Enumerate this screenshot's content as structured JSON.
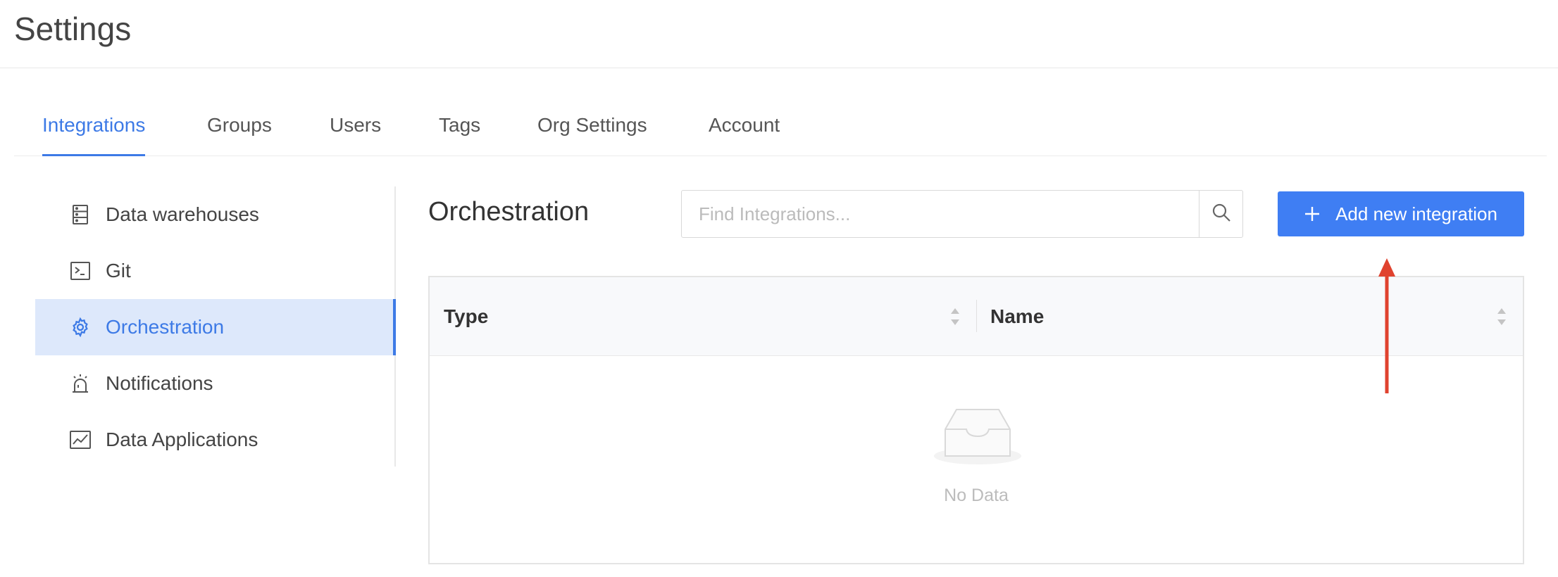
{
  "page": {
    "title": "Settings"
  },
  "tabs": [
    {
      "label": "Integrations",
      "active": true
    },
    {
      "label": "Groups",
      "active": false
    },
    {
      "label": "Users",
      "active": false
    },
    {
      "label": "Tags",
      "active": false
    },
    {
      "label": "Org Settings",
      "active": false
    },
    {
      "label": "Account",
      "active": false
    }
  ],
  "sidebar": {
    "items": [
      {
        "label": "Data warehouses",
        "icon": "database-icon",
        "active": false
      },
      {
        "label": "Git",
        "icon": "terminal-icon",
        "active": false
      },
      {
        "label": "Orchestration",
        "icon": "gear-icon",
        "active": true
      },
      {
        "label": "Notifications",
        "icon": "alarm-icon",
        "active": false
      },
      {
        "label": "Data Applications",
        "icon": "line-chart-icon",
        "active": false
      }
    ]
  },
  "main": {
    "title": "Orchestration",
    "search": {
      "placeholder": "Find Integrations...",
      "value": "",
      "icon": "search-icon"
    },
    "add_button": {
      "label": "Add new integration",
      "icon": "plus-icon"
    },
    "table": {
      "columns": [
        "Type",
        "Name"
      ],
      "rows": [],
      "empty_text": "No Data"
    }
  },
  "colors": {
    "accent": "#3d7ae6",
    "button": "#3f7ef3",
    "active_bg": "#dde8fb",
    "annotation_arrow": "#e0432f"
  }
}
